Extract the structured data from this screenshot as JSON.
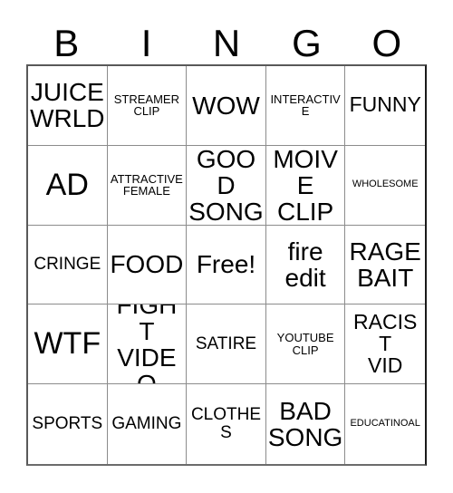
{
  "header": {
    "letters": [
      "B",
      "I",
      "N",
      "G",
      "O"
    ]
  },
  "grid": {
    "rows": 5,
    "columns": 5,
    "cells": [
      {
        "text": "JUICE\nWRLD",
        "size": "lg",
        "free": false
      },
      {
        "text": "STREAMER\nCLIP",
        "size": "xs",
        "free": false
      },
      {
        "text": "WOW",
        "size": "lg",
        "free": false
      },
      {
        "text": "INTERACTIVE",
        "size": "xs",
        "free": false
      },
      {
        "text": "FUNNY",
        "size": "md",
        "free": false
      },
      {
        "text": "AD",
        "size": "xl",
        "free": false
      },
      {
        "text": "ATTRACTIVE\nFEMALE",
        "size": "xs",
        "free": false
      },
      {
        "text": "GOOD\nSONG",
        "size": "lg",
        "free": false
      },
      {
        "text": "MOIVE\nCLIP",
        "size": "lg",
        "free": false
      },
      {
        "text": "WHOLESOME",
        "size": "xxs",
        "free": false
      },
      {
        "text": "CRINGE",
        "size": "sm",
        "free": false
      },
      {
        "text": "FOOD",
        "size": "lg",
        "free": false
      },
      {
        "text": "Free!",
        "size": "lg",
        "free": true
      },
      {
        "text": "fire\nedit",
        "size": "lg",
        "free": false
      },
      {
        "text": "RAGE\nBAIT",
        "size": "lg",
        "free": false
      },
      {
        "text": "WTF",
        "size": "xl",
        "free": false
      },
      {
        "text": "FIGHT\nVIDEO",
        "size": "lg",
        "free": false
      },
      {
        "text": "SATIRE",
        "size": "sm",
        "free": false
      },
      {
        "text": "YOUTUBE\nCLIP",
        "size": "xs",
        "free": false
      },
      {
        "text": "RACIST\nVID",
        "size": "md",
        "free": false
      },
      {
        "text": "SPORTS",
        "size": "sm",
        "free": false
      },
      {
        "text": "GAMING",
        "size": "sm",
        "free": false
      },
      {
        "text": "CLOTHES",
        "size": "sm",
        "free": false
      },
      {
        "text": "BAD\nSONG",
        "size": "lg",
        "free": false
      },
      {
        "text": "EDUCATINOAL",
        "size": "xxs",
        "free": false
      }
    ]
  },
  "colors": {
    "background": "#ffffff",
    "text": "#000000",
    "grid_line": "#8c8c8c",
    "grid_border": "#1a1a1a"
  }
}
